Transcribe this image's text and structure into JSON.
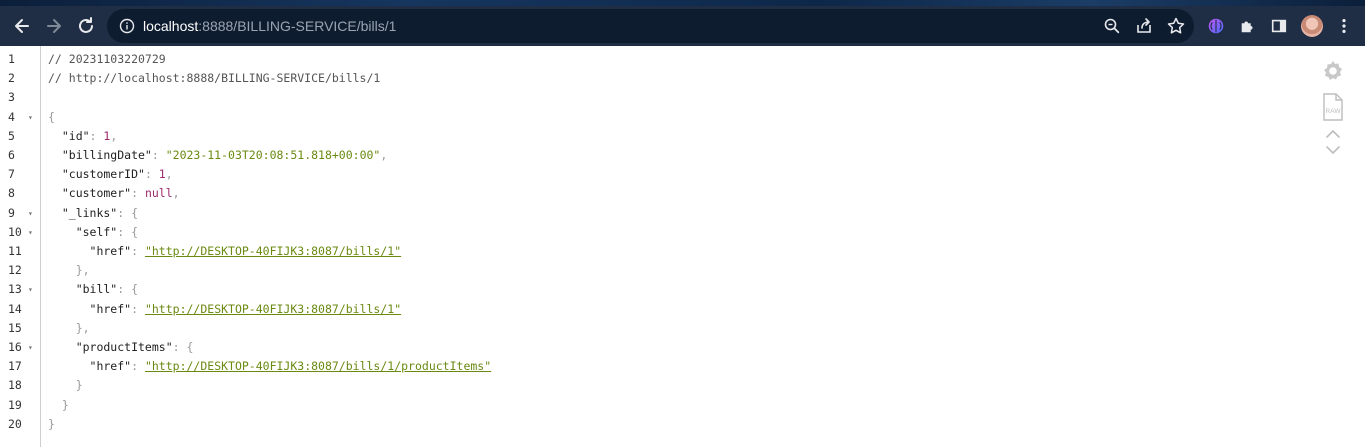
{
  "browser": {
    "url_host": "localhost",
    "url_rest": ":8888/BILLING-SERVICE/bills/1"
  },
  "viewer": {
    "lines": [
      {
        "n": "1",
        "fold": false,
        "parts": [
          {
            "t": "// 20231103220729",
            "c": "c-comment"
          }
        ]
      },
      {
        "n": "2",
        "fold": false,
        "parts": [
          {
            "t": "// http://localhost:8888/BILLING-SERVICE/bills/1",
            "c": "c-comment"
          }
        ]
      },
      {
        "n": "3",
        "fold": false,
        "parts": []
      },
      {
        "n": "4",
        "fold": true,
        "parts": [
          {
            "t": "{",
            "c": "c-punc"
          }
        ]
      },
      {
        "n": "5",
        "fold": false,
        "parts": [
          {
            "t": "  \"id\"",
            "c": "c-key"
          },
          {
            "t": ": ",
            "c": "c-punc"
          },
          {
            "t": "1",
            "c": "c-num"
          },
          {
            "t": ",",
            "c": "c-punc"
          }
        ]
      },
      {
        "n": "6",
        "fold": false,
        "parts": [
          {
            "t": "  \"billingDate\"",
            "c": "c-key"
          },
          {
            "t": ": ",
            "c": "c-punc"
          },
          {
            "t": "\"2023-11-03T20:08:51.818+00:00\"",
            "c": "c-str"
          },
          {
            "t": ",",
            "c": "c-punc"
          }
        ]
      },
      {
        "n": "7",
        "fold": false,
        "parts": [
          {
            "t": "  \"customerID\"",
            "c": "c-key"
          },
          {
            "t": ": ",
            "c": "c-punc"
          },
          {
            "t": "1",
            "c": "c-num"
          },
          {
            "t": ",",
            "c": "c-punc"
          }
        ]
      },
      {
        "n": "8",
        "fold": false,
        "parts": [
          {
            "t": "  \"customer\"",
            "c": "c-key"
          },
          {
            "t": ": ",
            "c": "c-punc"
          },
          {
            "t": "null",
            "c": "c-null"
          },
          {
            "t": ",",
            "c": "c-punc"
          }
        ]
      },
      {
        "n": "9",
        "fold": true,
        "parts": [
          {
            "t": "  \"_links\"",
            "c": "c-key"
          },
          {
            "t": ": {",
            "c": "c-punc"
          }
        ]
      },
      {
        "n": "10",
        "fold": true,
        "parts": [
          {
            "t": "    \"self\"",
            "c": "c-key"
          },
          {
            "t": ": {",
            "c": "c-punc"
          }
        ]
      },
      {
        "n": "11",
        "fold": false,
        "parts": [
          {
            "t": "      \"href\"",
            "c": "c-key"
          },
          {
            "t": ": ",
            "c": "c-punc"
          },
          {
            "t": "\"http://DESKTOP-40FIJK3:8087/bills/1\"",
            "c": "c-link",
            "link": true
          }
        ]
      },
      {
        "n": "12",
        "fold": false,
        "parts": [
          {
            "t": "    },",
            "c": "c-punc"
          }
        ]
      },
      {
        "n": "13",
        "fold": true,
        "parts": [
          {
            "t": "    \"bill\"",
            "c": "c-key"
          },
          {
            "t": ": {",
            "c": "c-punc"
          }
        ]
      },
      {
        "n": "14",
        "fold": false,
        "parts": [
          {
            "t": "      \"href\"",
            "c": "c-key"
          },
          {
            "t": ": ",
            "c": "c-punc"
          },
          {
            "t": "\"http://DESKTOP-40FIJK3:8087/bills/1\"",
            "c": "c-link",
            "link": true
          }
        ]
      },
      {
        "n": "15",
        "fold": false,
        "parts": [
          {
            "t": "    },",
            "c": "c-punc"
          }
        ]
      },
      {
        "n": "16",
        "fold": true,
        "parts": [
          {
            "t": "    \"productItems\"",
            "c": "c-key"
          },
          {
            "t": ": {",
            "c": "c-punc"
          }
        ]
      },
      {
        "n": "17",
        "fold": false,
        "parts": [
          {
            "t": "      \"href\"",
            "c": "c-key"
          },
          {
            "t": ": ",
            "c": "c-punc"
          },
          {
            "t": "\"http://DESKTOP-40FIJK3:8087/bills/1/productItems\"",
            "c": "c-link",
            "link": true
          }
        ]
      },
      {
        "n": "18",
        "fold": false,
        "parts": [
          {
            "t": "    }",
            "c": "c-punc"
          }
        ]
      },
      {
        "n": "19",
        "fold": false,
        "parts": [
          {
            "t": "  }",
            "c": "c-punc"
          }
        ]
      },
      {
        "n": "20",
        "fold": false,
        "parts": [
          {
            "t": "}",
            "c": "c-punc"
          }
        ]
      }
    ],
    "raw_label": "RAW"
  }
}
